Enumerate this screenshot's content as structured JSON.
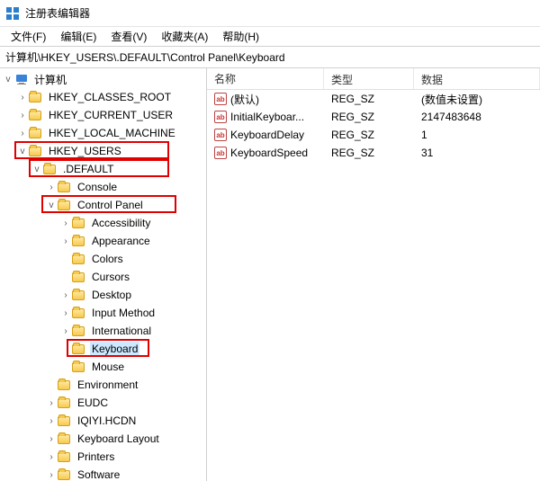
{
  "window": {
    "title": "注册表编辑器"
  },
  "menu": {
    "file": "文件(F)",
    "edit": "编辑(E)",
    "view": "查看(V)",
    "favorites": "收藏夹(A)",
    "help": "帮助(H)"
  },
  "address": {
    "path": "计算机\\HKEY_USERS\\.DEFAULT\\Control Panel\\Keyboard"
  },
  "tree": {
    "root": "计算机",
    "hkcr": "HKEY_CLASSES_ROOT",
    "hkcu": "HKEY_CURRENT_USER",
    "hklm": "HKEY_LOCAL_MACHINE",
    "hku": "HKEY_USERS",
    "default": ".DEFAULT",
    "console": "Console",
    "cpl": "Control Panel",
    "accessibility": "Accessibility",
    "appearance": "Appearance",
    "colors": "Colors",
    "cursors": "Cursors",
    "desktop": "Desktop",
    "input_method": "Input Method",
    "international": "International",
    "keyboard": "Keyboard",
    "mouse": "Mouse",
    "environment": "Environment",
    "eudc": "EUDC",
    "iqiyi": "IQIYI.HCDN",
    "kbd_layout": "Keyboard Layout",
    "printers": "Printers",
    "software": "Software"
  },
  "list": {
    "headers": {
      "name": "名称",
      "type": "类型",
      "data": "数据"
    },
    "rows": [
      {
        "name": "(默认)",
        "type": "REG_SZ",
        "data": "(数值未设置)"
      },
      {
        "name": "InitialKeyboar...",
        "type": "REG_SZ",
        "data": "2147483648"
      },
      {
        "name": "KeyboardDelay",
        "type": "REG_SZ",
        "data": "1"
      },
      {
        "name": "KeyboardSpeed",
        "type": "REG_SZ",
        "data": "31"
      }
    ]
  }
}
